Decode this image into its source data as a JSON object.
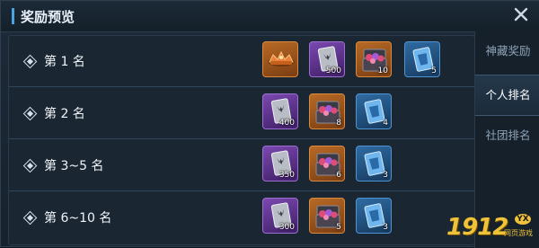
{
  "window": {
    "title": "奖励预览"
  },
  "tabs": [
    {
      "label": "神藏奖励",
      "active": false
    },
    {
      "label": "个人排名",
      "active": true
    },
    {
      "label": "社团排名",
      "active": false
    }
  ],
  "rows": [
    {
      "label": "第 1 名",
      "items": [
        {
          "icon": "bronze-crown-icon",
          "quality": "orange",
          "qty": ""
        },
        {
          "icon": "silver-card-icon",
          "quality": "purple",
          "qty": "500"
        },
        {
          "icon": "gem-chest-icon",
          "quality": "orange",
          "qty": "10"
        },
        {
          "icon": "blue-card-icon",
          "quality": "blue",
          "qty": "5"
        }
      ]
    },
    {
      "label": "第 2 名",
      "items": [
        {
          "icon": "silver-card-icon",
          "quality": "purple",
          "qty": "400"
        },
        {
          "icon": "gem-chest-icon",
          "quality": "orange",
          "qty": "8"
        },
        {
          "icon": "blue-card-icon",
          "quality": "blue",
          "qty": "4"
        }
      ]
    },
    {
      "label": "第 3~5 名",
      "items": [
        {
          "icon": "silver-card-icon",
          "quality": "purple",
          "qty": "350"
        },
        {
          "icon": "gem-chest-icon",
          "quality": "orange",
          "qty": "6"
        },
        {
          "icon": "blue-card-icon",
          "quality": "blue",
          "qty": "3"
        }
      ]
    },
    {
      "label": "第 6~10 名",
      "items": [
        {
          "icon": "silver-card-icon",
          "quality": "purple",
          "qty": "300"
        },
        {
          "icon": "gem-chest-icon",
          "quality": "orange",
          "qty": "5"
        },
        {
          "icon": "blue-card-icon",
          "quality": "blue",
          "qty": "3"
        }
      ]
    }
  ],
  "watermark": {
    "number": "1912",
    "badge": "YX",
    "subtitle": "网页游戏"
  },
  "colors": {
    "accent": "#4aa3e0",
    "orange_quality": "#d98a3c",
    "purple_quality": "#9a6fd0",
    "blue_quality": "#4f94d2",
    "logo": "#f0c23a"
  }
}
